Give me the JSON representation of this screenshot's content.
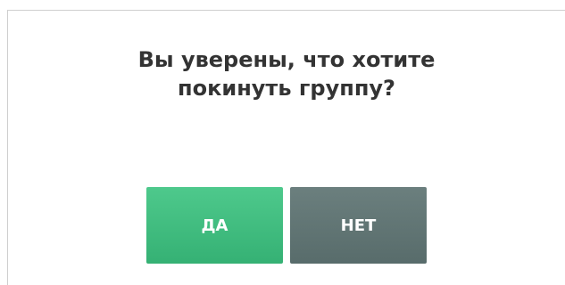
{
  "dialog": {
    "message_line1": "Вы уверены, что хотите",
    "message_line2": "покинуть группу?",
    "yes_label": "ДА",
    "no_label": "НЕТ"
  },
  "colors": {
    "yes_button": "#3cbc7e",
    "no_button": "#627675",
    "text": "#333333"
  }
}
